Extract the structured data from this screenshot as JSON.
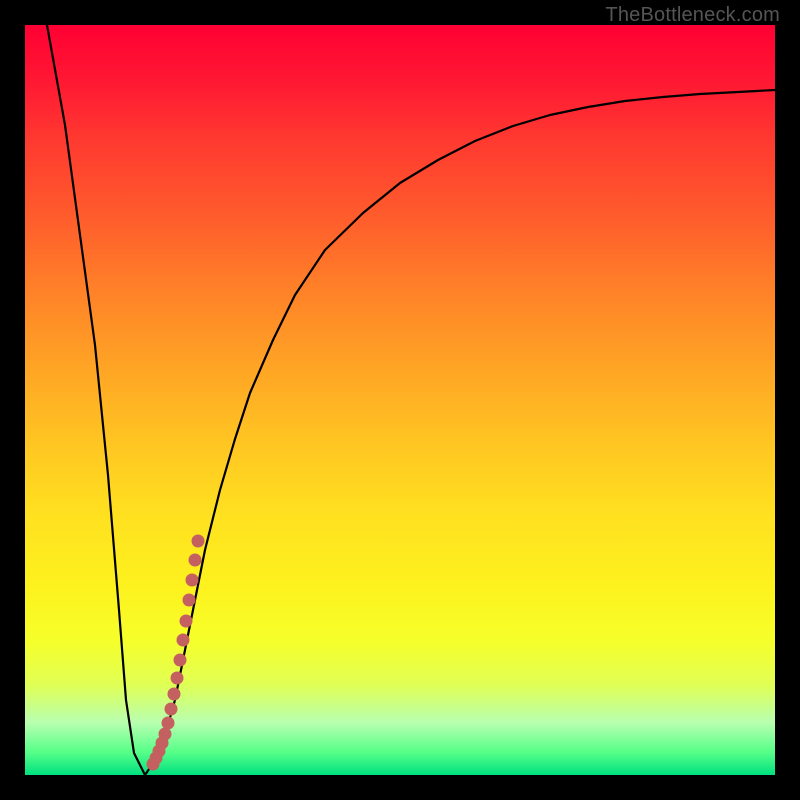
{
  "attribution": "TheBottleneck.com",
  "colors": {
    "dot": "#c46060",
    "curve": "#000000",
    "background_black": "#000000"
  },
  "chart_data": {
    "type": "line",
    "title": "",
    "xlabel": "",
    "ylabel": "",
    "xlim": [
      0,
      100
    ],
    "ylim": [
      0,
      100
    ],
    "series": [
      {
        "name": "bottleneck-curve",
        "x": [
          3,
          5,
          7,
          9,
          11,
          12.5,
          13.5,
          14.5,
          16,
          18,
          20,
          22,
          24,
          26,
          28,
          30,
          33,
          36,
          40,
          45,
          50,
          55,
          60,
          65,
          70,
          75,
          80,
          85,
          90,
          95,
          100
        ],
        "y": [
          100,
          86,
          72,
          58,
          40,
          22,
          10,
          3,
          0,
          3,
          10,
          20,
          30,
          38,
          45,
          51,
          58,
          64,
          70,
          75,
          79,
          82,
          84.5,
          86.5,
          88,
          89,
          89.8,
          90.4,
          90.8,
          91.1,
          91.3
        ]
      },
      {
        "name": "highlight-dots",
        "x": [
          17.0,
          17.4,
          17.8,
          18.2,
          18.6,
          19.0,
          19.4,
          19.8,
          20.2,
          20.6,
          21.0,
          21.4,
          21.8,
          22.2,
          22.6,
          23.0
        ],
        "y": [
          1.5,
          2.3,
          3.2,
          4.3,
          5.5,
          7.0,
          8.8,
          10.8,
          13.0,
          15.4,
          18.0,
          20.6,
          23.3,
          26.0,
          28.7,
          31.2
        ]
      }
    ],
    "notes": "Values are read approximately from pixel positions; axes have no visible tick labels."
  }
}
